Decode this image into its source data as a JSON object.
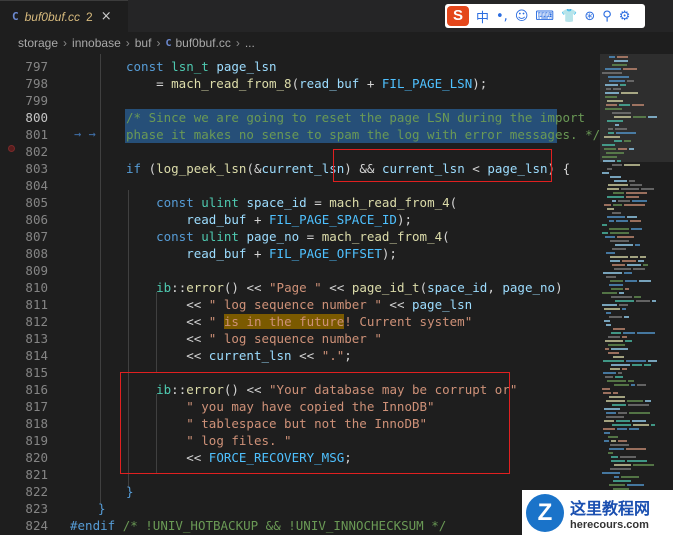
{
  "tab": {
    "icon": "C",
    "filename": "buf0buf.cc",
    "problem_count": "2",
    "close": "×"
  },
  "ime_toolbar": {
    "logo": "S",
    "chars": [
      "中",
      "•,",
      "☺",
      "⌨",
      "👕",
      "⊛",
      "⚲",
      "⚙"
    ]
  },
  "breadcrumb": [
    "storage",
    "innobase",
    "buf",
    "buf0buf.cc",
    "..."
  ],
  "lines": [
    {
      "n": "797",
      "html": "<span class=\"kw\">const</span> <span class=\"ty\">lsn_t</span> <span class=\"var\">page_lsn</span>"
    },
    {
      "n": "798",
      "html": "    = <span class=\"fn\">mach_read_from_8</span>(<span class=\"var\">read_buf</span> + <span class=\"mc\">FIL_PAGE_LSN</span>);"
    },
    {
      "n": "799",
      "html": ""
    },
    {
      "n": "800",
      "html": "<span class=\"cm\">/* Since we are going to reset the page LSN during the import</span>"
    },
    {
      "n": "801",
      "html": "<span class=\"cm\">phase it makes no sense to spam the log with error messages. */</span>"
    },
    {
      "n": "802",
      "html": ""
    },
    {
      "n": "803",
      "html": "<span class=\"kw\">if</span> (<span class=\"fn\">log_peek_lsn</span>(&amp;<span class=\"var\">current_lsn</span>) &amp;&amp; <span class=\"var\">current_lsn</span> &lt; <span class=\"var\">page_lsn</span>) {"
    },
    {
      "n": "804",
      "html": ""
    },
    {
      "n": "805",
      "html": "    <span class=\"kw\">const</span> <span class=\"ty\">ulint</span> <span class=\"var\">space_id</span> = <span class=\"fn\">mach_read_from_4</span>("
    },
    {
      "n": "806",
      "html": "        <span class=\"var\">read_buf</span> + <span class=\"mc\">FIL_PAGE_SPACE_ID</span>);"
    },
    {
      "n": "807",
      "html": "    <span class=\"kw\">const</span> <span class=\"ty\">ulint</span> <span class=\"var\">page_no</span> = <span class=\"fn\">mach_read_from_4</span>("
    },
    {
      "n": "808",
      "html": "        <span class=\"var\">read_buf</span> + <span class=\"mc\">FIL_PAGE_OFFSET</span>);"
    },
    {
      "n": "809",
      "html": ""
    },
    {
      "n": "810",
      "html": "    <span class=\"ty\">ib</span>::<span class=\"fn\">error</span>() &lt;&lt; <span class=\"str\">\"Page \"</span> &lt;&lt; <span class=\"fn\">page_id_t</span>(<span class=\"var\">space_id</span>, <span class=\"var\">page_no</span>)"
    },
    {
      "n": "811",
      "html": "        &lt;&lt; <span class=\"str\">\" log sequence number \"</span> &lt;&lt; <span class=\"var\">page_lsn</span>"
    },
    {
      "n": "812",
      "html": "        &lt;&lt; <span class=\"str\">\" </span><span class=\"hl\">is in the future</span><span class=\"str\">! Current system\"</span>"
    },
    {
      "n": "813",
      "html": "        &lt;&lt; <span class=\"str\">\" log sequence number \"</span>"
    },
    {
      "n": "814",
      "html": "        &lt;&lt; <span class=\"var\">current_lsn</span> &lt;&lt; <span class=\"str\">\".\"</span>;"
    },
    {
      "n": "815",
      "html": ""
    },
    {
      "n": "816",
      "html": "    <span class=\"ty\">ib</span>::<span class=\"fn\">error</span>() &lt;&lt; <span class=\"str\">\"Your database may be corrupt or\"</span>"
    },
    {
      "n": "817",
      "html": "        <span class=\"str\">\" you may have copied the InnoDB\"</span>"
    },
    {
      "n": "818",
      "html": "        <span class=\"str\">\" tablespace but not the InnoDB\"</span>"
    },
    {
      "n": "819",
      "html": "        <span class=\"str\">\" log files. \"</span>"
    },
    {
      "n": "820",
      "html": "        &lt;&lt; <span class=\"mc\">FORCE_RECOVERY_MSG</span>;"
    },
    {
      "n": "821",
      "html": ""
    },
    {
      "n": "822",
      "html": "<span class=\"kw\">}</span>"
    },
    {
      "n": "823",
      "html": "<span class=\"kw\">}</span>"
    },
    {
      "n": "824",
      "html": "<span class=\"kw\">#endif</span> <span class=\"cm\">/* !UNIV_HOTBACKUP &amp;&amp; !UNIV_INNOCHECKSUM */</span>"
    }
  ],
  "current_line": "800",
  "watermark": {
    "logo": "Z",
    "title": "这里教程网",
    "url": "herecours.com"
  }
}
